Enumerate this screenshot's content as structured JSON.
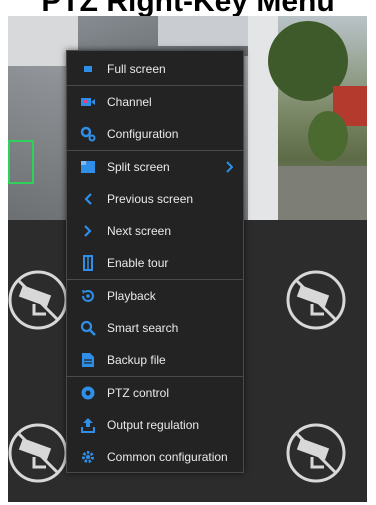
{
  "heading": "PTZ Right-Key Menu",
  "menu": {
    "items": [
      {
        "label": "Full screen",
        "icon": "full-screen-icon"
      },
      {
        "label": "Channel",
        "icon": "channel-icon"
      },
      {
        "label": "Configuration",
        "icon": "configuration-icon"
      },
      {
        "label": "Split screen",
        "icon": "split-screen-icon"
      },
      {
        "label": "Previous screen",
        "icon": "previous-screen-icon"
      },
      {
        "label": "Next screen",
        "icon": "next-screen-icon"
      },
      {
        "label": "Enable tour",
        "icon": "enable-tour-icon"
      },
      {
        "label": "Playback",
        "icon": "playback-icon"
      },
      {
        "label": "Smart search",
        "icon": "smart-search-icon"
      },
      {
        "label": "Backup file",
        "icon": "backup-file-icon"
      },
      {
        "label": "PTZ control",
        "icon": "ptz-control-icon"
      },
      {
        "label": "Output regulation",
        "icon": "output-regulation-icon"
      },
      {
        "label": "Common configuration",
        "icon": "common-configuration-icon"
      }
    ]
  },
  "colors": {
    "accent": "#2f8fe8",
    "menu_bg": "#232323",
    "separator": "#4a4a4a",
    "motion_box": "#2fd15a"
  }
}
